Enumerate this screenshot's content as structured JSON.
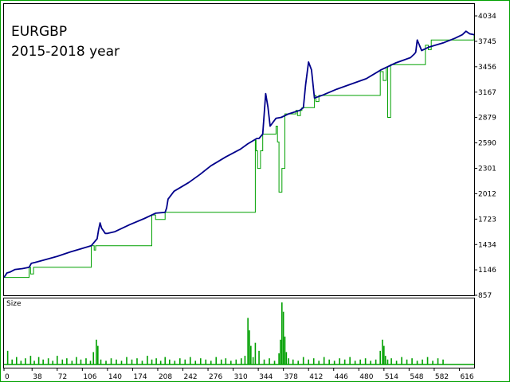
{
  "title": "EURGBP",
  "subtitle": "2015-2018 year",
  "chart_data": [
    {
      "type": "line",
      "title": "EURGBP",
      "subtitle": "2015-2018 year",
      "xlim": [
        0,
        636
      ],
      "ylim": [
        857,
        4034
      ],
      "y_ticks": [
        4034,
        3745,
        3456,
        3167,
        2879,
        2590,
        2301,
        2012,
        1723,
        1434,
        1146,
        857
      ],
      "grid": false,
      "colors": {
        "balance": "#00008b",
        "equity": "#00a000",
        "border": "#00a000"
      },
      "series": [
        {
          "x": [
            0,
            4,
            8,
            15,
            25,
            34,
            37,
            42,
            55,
            72,
            90,
            106,
            118,
            126,
            128,
            130,
            132,
            137,
            140,
            150,
            170,
            190,
            205,
            218,
            220,
            222,
            230,
            250,
            265,
            280,
            300,
            320,
            330,
            342,
            345,
            350,
            354,
            357,
            360,
            368,
            375,
            385,
            400,
            405,
            408,
            412,
            416,
            420,
            430,
            450,
            470,
            490,
            510,
            530,
            550,
            555,
            557,
            559,
            562,
            565,
            575,
            595,
            610,
            620,
            625,
            630,
            636
          ],
          "y": [
            1060,
            1110,
            1120,
            1150,
            1160,
            1175,
            1220,
            1230,
            1260,
            1300,
            1350,
            1390,
            1420,
            1500,
            1600,
            1680,
            1620,
            1560,
            1560,
            1580,
            1660,
            1730,
            1790,
            1800,
            1850,
            1950,
            2040,
            2140,
            2230,
            2330,
            2430,
            2520,
            2580,
            2640,
            2640,
            2690,
            3150,
            3000,
            2780,
            2870,
            2880,
            2920,
            2960,
            2990,
            3250,
            3510,
            3420,
            3100,
            3130,
            3200,
            3260,
            3320,
            3420,
            3500,
            3560,
            3600,
            3620,
            3760,
            3700,
            3640,
            3680,
            3730,
            3780,
            3820,
            3860,
            3830,
            3820
          ]
        },
        {
          "x": [
            0,
            34,
            36,
            38,
            40,
            118,
            120,
            122,
            124,
            200,
            203,
            205,
            215,
            218,
            220,
            340,
            341,
            343,
            346,
            347,
            350,
            368,
            370,
            372,
            375,
            376,
            380,
            395,
            397,
            399,
            401,
            403,
            420,
            422,
            424,
            426,
            428,
            430,
            509,
            511,
            513,
            515,
            517,
            519,
            521,
            523,
            570,
            572,
            574,
            576,
            578,
            636
          ],
          "y": [
            1060,
            1175,
            1100,
            1100,
            1175,
            1420,
            1420,
            1370,
            1420,
            1770,
            1770,
            1720,
            1720,
            1800,
            1800,
            2620,
            2500,
            2300,
            2300,
            2500,
            2690,
            2780,
            2600,
            2030,
            2030,
            2300,
            2920,
            2960,
            2900,
            2900,
            2960,
            2990,
            3130,
            3060,
            3060,
            3130,
            3130,
            3130,
            3400,
            3400,
            3300,
            3300,
            3450,
            2880,
            2880,
            3480,
            3700,
            3700,
            3650,
            3650,
            3760,
            3820
          ]
        }
      ],
      "sub_charts": [
        {
          "type": "bar",
          "label": "Size",
          "x_ticks": [
            0,
            38,
            72,
            106,
            140,
            174,
            208,
            242,
            276,
            310,
            344,
            378,
            412,
            446,
            480,
            514,
            548,
            582,
            616
          ],
          "xlim": [
            0,
            636
          ],
          "ylim": [
            0,
            100
          ],
          "x": [
            5,
            11,
            17,
            23,
            29,
            36,
            41,
            47,
            53,
            60,
            66,
            72,
            79,
            85,
            92,
            98,
            104,
            111,
            117,
            121,
            125,
            127,
            131,
            138,
            145,
            152,
            159,
            166,
            173,
            180,
            187,
            194,
            200,
            206,
            212,
            218,
            224,
            231,
            238,
            245,
            252,
            259,
            266,
            273,
            280,
            287,
            294,
            300,
            307,
            314,
            321,
            326,
            330,
            332,
            334,
            337,
            340,
            345,
            352,
            359,
            366,
            372,
            374,
            376,
            378,
            380,
            382,
            385,
            391,
            398,
            405,
            412,
            419,
            426,
            433,
            440,
            447,
            454,
            461,
            468,
            475,
            482,
            489,
            496,
            503,
            509,
            512,
            514,
            516,
            519,
            524,
            531,
            538,
            545,
            552,
            559,
            566,
            573,
            580,
            587,
            594
          ],
          "values": [
            22,
            8,
            12,
            6,
            10,
            14,
            6,
            12,
            8,
            10,
            6,
            14,
            8,
            10,
            6,
            12,
            8,
            10,
            6,
            20,
            40,
            30,
            8,
            6,
            10,
            8,
            6,
            12,
            8,
            10,
            6,
            14,
            8,
            10,
            6,
            12,
            8,
            6,
            10,
            8,
            12,
            6,
            10,
            8,
            6,
            12,
            8,
            10,
            6,
            8,
            10,
            14,
            75,
            55,
            30,
            12,
            35,
            22,
            8,
            10,
            6,
            18,
            40,
            100,
            85,
            45,
            20,
            10,
            8,
            6,
            12,
            8,
            10,
            6,
            12,
            8,
            6,
            10,
            8,
            12,
            6,
            8,
            10,
            6,
            8,
            22,
            40,
            30,
            14,
            8,
            10,
            6,
            12,
            8,
            10,
            6,
            8,
            12,
            6,
            10,
            8
          ]
        }
      ]
    }
  ]
}
